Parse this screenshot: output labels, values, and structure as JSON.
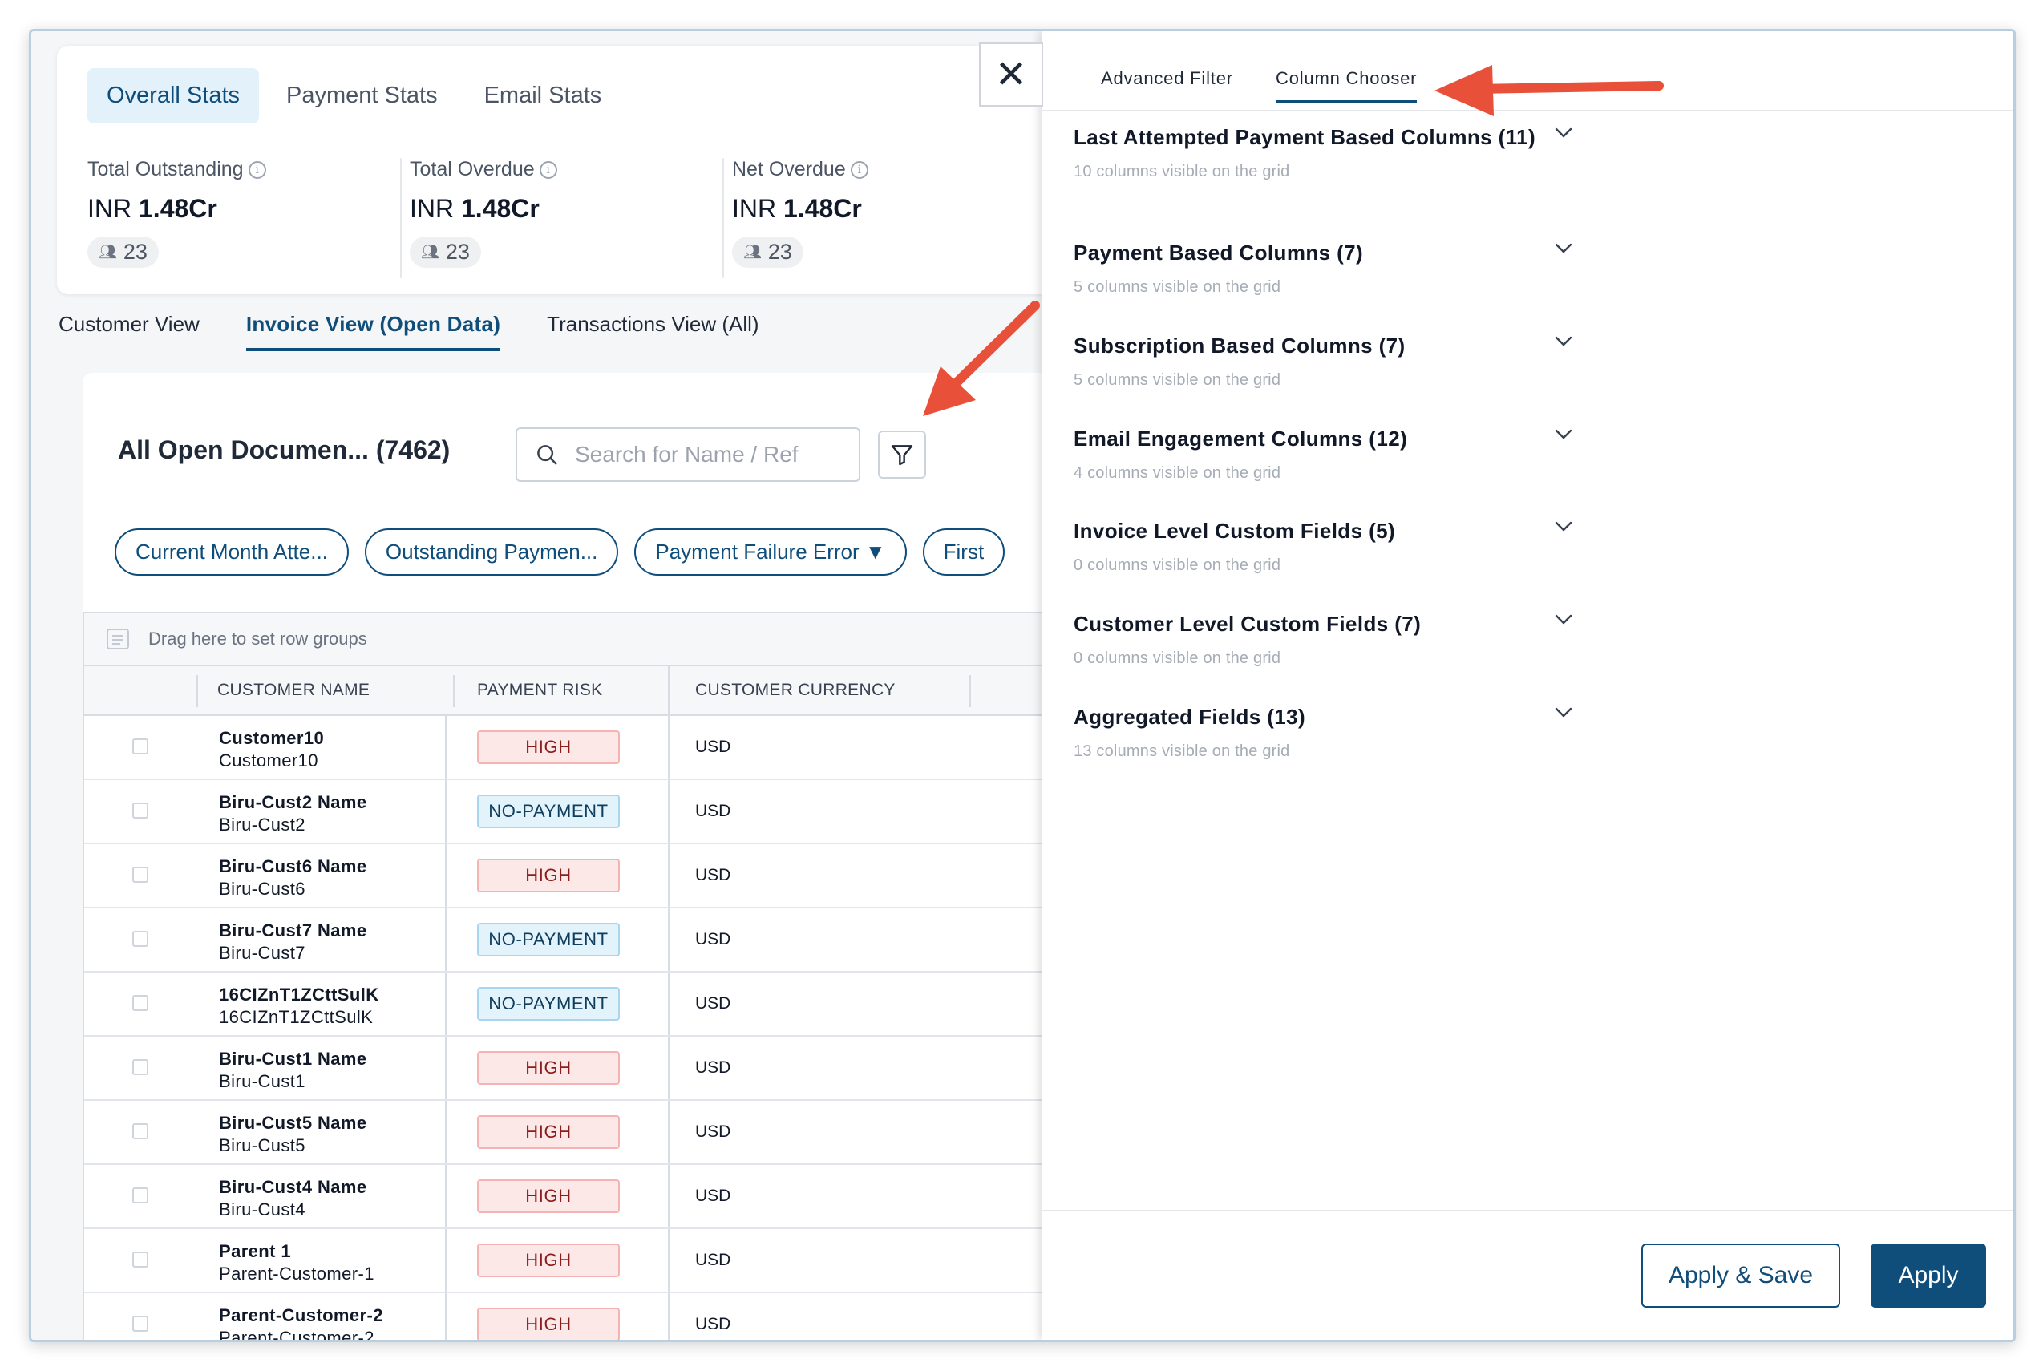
{
  "stats": {
    "tabs": [
      {
        "label": "Overall Stats",
        "active": true
      },
      {
        "label": "Payment Stats",
        "active": false
      },
      {
        "label": "Email Stats",
        "active": false
      }
    ],
    "metrics": [
      {
        "label": "Total Outstanding",
        "currency": "INR",
        "value": "1.48Cr",
        "count": "23"
      },
      {
        "label": "Total Overdue",
        "currency": "INR",
        "value": "1.48Cr",
        "count": "23"
      },
      {
        "label": "Net Overdue",
        "currency": "INR",
        "value": "1.48Cr",
        "count": "23"
      }
    ]
  },
  "view_tabs": [
    {
      "label": "Customer View",
      "active": false
    },
    {
      "label": "Invoice View (Open Data)",
      "active": true
    },
    {
      "label": "Transactions View (All)",
      "active": false
    }
  ],
  "grid": {
    "title": "All Open Documen... (7462)",
    "search_placeholder": "Search for Name / Ref",
    "chips": [
      "Current Month Atte...",
      "Outstanding Paymen...",
      "Payment Failure Error ▼",
      "First"
    ],
    "group_bar_text": "Drag here to set row groups",
    "columns": [
      "CUSTOMER NAME",
      "PAYMENT RISK",
      "CUSTOMER CURRENCY"
    ],
    "rows": [
      {
        "name": "Customer10",
        "sub": "Customer10",
        "risk": "HIGH",
        "risk_type": "high",
        "currency": "USD"
      },
      {
        "name": "Biru-Cust2 Name",
        "sub": "Biru-Cust2",
        "risk": "NO-PAYMENT",
        "risk_type": "nopay",
        "currency": "USD"
      },
      {
        "name": "Biru-Cust6 Name",
        "sub": "Biru-Cust6",
        "risk": "HIGH",
        "risk_type": "high",
        "currency": "USD"
      },
      {
        "name": "Biru-Cust7 Name",
        "sub": "Biru-Cust7",
        "risk": "NO-PAYMENT",
        "risk_type": "nopay",
        "currency": "USD"
      },
      {
        "name": "16CIZnT1ZCttSulK",
        "sub": "16CIZnT1ZCttSulK",
        "risk": "NO-PAYMENT",
        "risk_type": "nopay",
        "currency": "USD"
      },
      {
        "name": "Biru-Cust1 Name",
        "sub": "Biru-Cust1",
        "risk": "HIGH",
        "risk_type": "high",
        "currency": "USD"
      },
      {
        "name": "Biru-Cust5 Name",
        "sub": "Biru-Cust5",
        "risk": "HIGH",
        "risk_type": "high",
        "currency": "USD"
      },
      {
        "name": "Biru-Cust4 Name",
        "sub": "Biru-Cust4",
        "risk": "HIGH",
        "risk_type": "high",
        "currency": "USD"
      },
      {
        "name": "Parent 1",
        "sub": "Parent-Customer-1",
        "risk": "HIGH",
        "risk_type": "high",
        "currency": "USD"
      },
      {
        "name": "Parent-Customer-2",
        "sub": "Parent-Customer-2",
        "risk": "HIGH",
        "risk_type": "high",
        "currency": "USD"
      }
    ]
  },
  "close_label": "✕",
  "drawer": {
    "tabs": [
      {
        "label": "Advanced Filter",
        "active": false
      },
      {
        "label": "Column Chooser",
        "active": true
      }
    ],
    "sections": [
      {
        "title": "Last Attempted Payment Based Columns (11)",
        "sub": "10 columns visible on the grid"
      },
      {
        "title": "Payment Based Columns (7)",
        "sub": "5 columns visible on the grid"
      },
      {
        "title": "Subscription Based Columns (7)",
        "sub": "5 columns visible on the grid"
      },
      {
        "title": "Email Engagement Columns (12)",
        "sub": "4 columns visible on the grid"
      },
      {
        "title": "Invoice Level Custom Fields (5)",
        "sub": "0 columns visible on the grid"
      },
      {
        "title": "Customer Level Custom Fields (7)",
        "sub": "0 columns visible on the grid"
      },
      {
        "title": "Aggregated Fields (13)",
        "sub": "13 columns visible on the grid"
      }
    ],
    "apply_save_label": "Apply & Save",
    "apply_label": "Apply"
  },
  "colors": {
    "primary": "#0f4d7a",
    "arrow": "#e8503a",
    "high_bg": "#fde8e8",
    "nopay_bg": "#e2f3fb"
  }
}
